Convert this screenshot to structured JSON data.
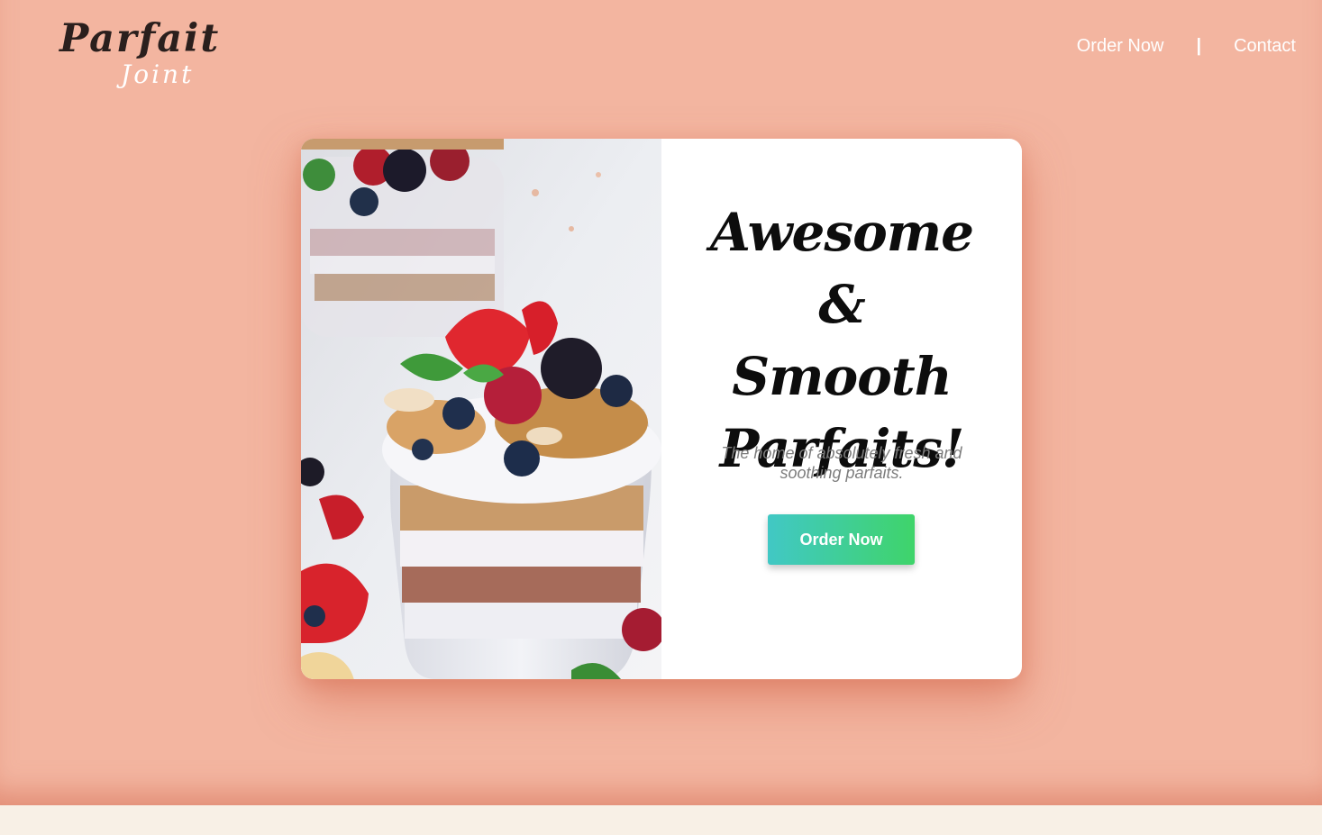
{
  "brand": {
    "logo_main": "Parfait",
    "logo_sub": "Joint"
  },
  "nav": {
    "order_now": "Order Now",
    "separator": "|",
    "contact": "Contact"
  },
  "hero": {
    "headline_line1": "Awesome &",
    "headline_line2": "Smooth",
    "headline_line3": "Parfaits!",
    "tagline": "The home of absolutely fresh and soothing parfaits.",
    "cta_label": "Order Now"
  },
  "colors": {
    "background": "#f3b5a0",
    "footer": "#f8f0e6",
    "card": "#ffffff",
    "cta_gradient_start": "#41c8c5",
    "cta_gradient_end": "#3fd46a"
  }
}
